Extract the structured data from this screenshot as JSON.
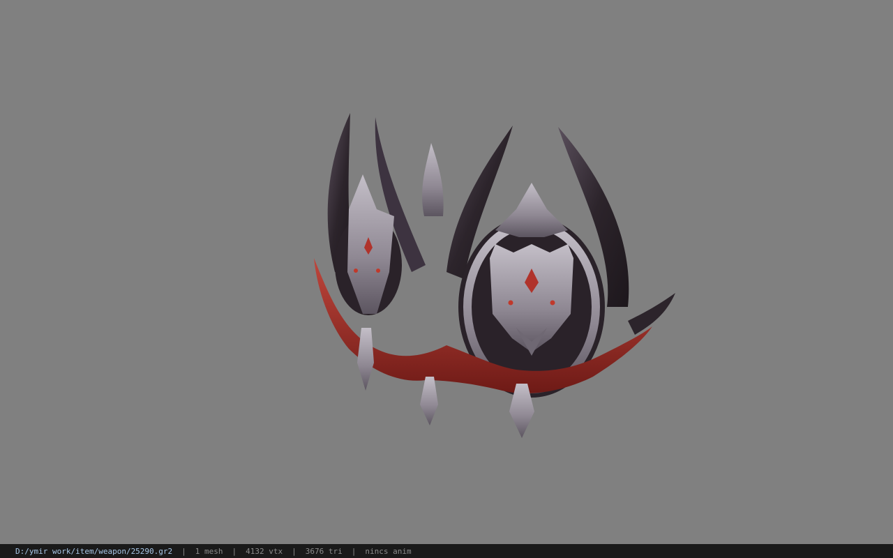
{
  "colors": {
    "viewport_bg": "#808080",
    "status_bg": "#1a1a1a",
    "path_text": "#a9c8e8",
    "stat_text": "#8c8c8c",
    "metal_dark": "#2a2229",
    "metal_purple": "#4e4350",
    "silver": "#a7a2ab",
    "red_accent": "#9b2a24"
  },
  "status": {
    "file_path": "D:/ymir work/item/weapon/25290.gr2",
    "separator": "|",
    "mesh_count": "1 mesh",
    "vertex_count": "4132 vtx",
    "triangle_count": "3676 tri",
    "anim_status": "nincs anim"
  }
}
